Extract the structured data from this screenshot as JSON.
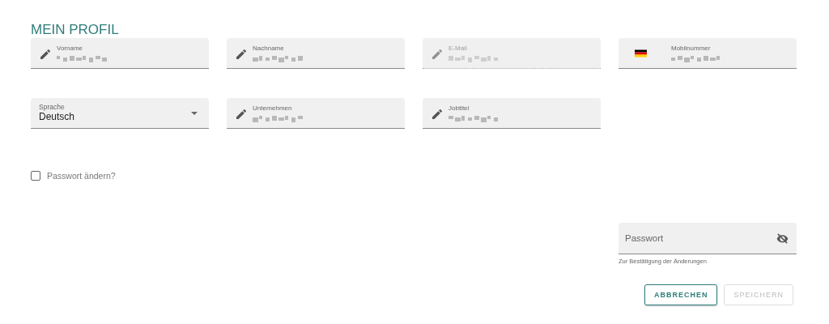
{
  "title": "MEIN PROFIL",
  "fields": [
    {
      "kind": "text",
      "label": "Vorname",
      "value_redacted": true,
      "disabled": false
    },
    {
      "kind": "text",
      "label": "Nachname",
      "value_redacted": true,
      "disabled": false
    },
    {
      "kind": "text",
      "label": "E-Mail",
      "value_redacted": true,
      "disabled": true
    },
    {
      "kind": "phone",
      "label": "Mobilnummer",
      "value_redacted": true,
      "disabled": false
    },
    {
      "kind": "select",
      "label": "Sprache",
      "value": "Deutsch",
      "disabled": false
    },
    {
      "kind": "text",
      "label": "Unternehmen",
      "value_redacted": true,
      "disabled": false
    },
    {
      "kind": "text",
      "label": "Jobtitel",
      "value_redacted": true,
      "disabled": false
    }
  ],
  "change_password": {
    "label": "Passwort ändern?",
    "checked": false
  },
  "password": {
    "placeholder": "Passwort",
    "hint": "Zur Bestätigung der Änderungen"
  },
  "buttons": [
    {
      "label": "ABBRECHEN",
      "disabled": false
    },
    {
      "label": "SPEICHERN",
      "disabled": true
    }
  ]
}
